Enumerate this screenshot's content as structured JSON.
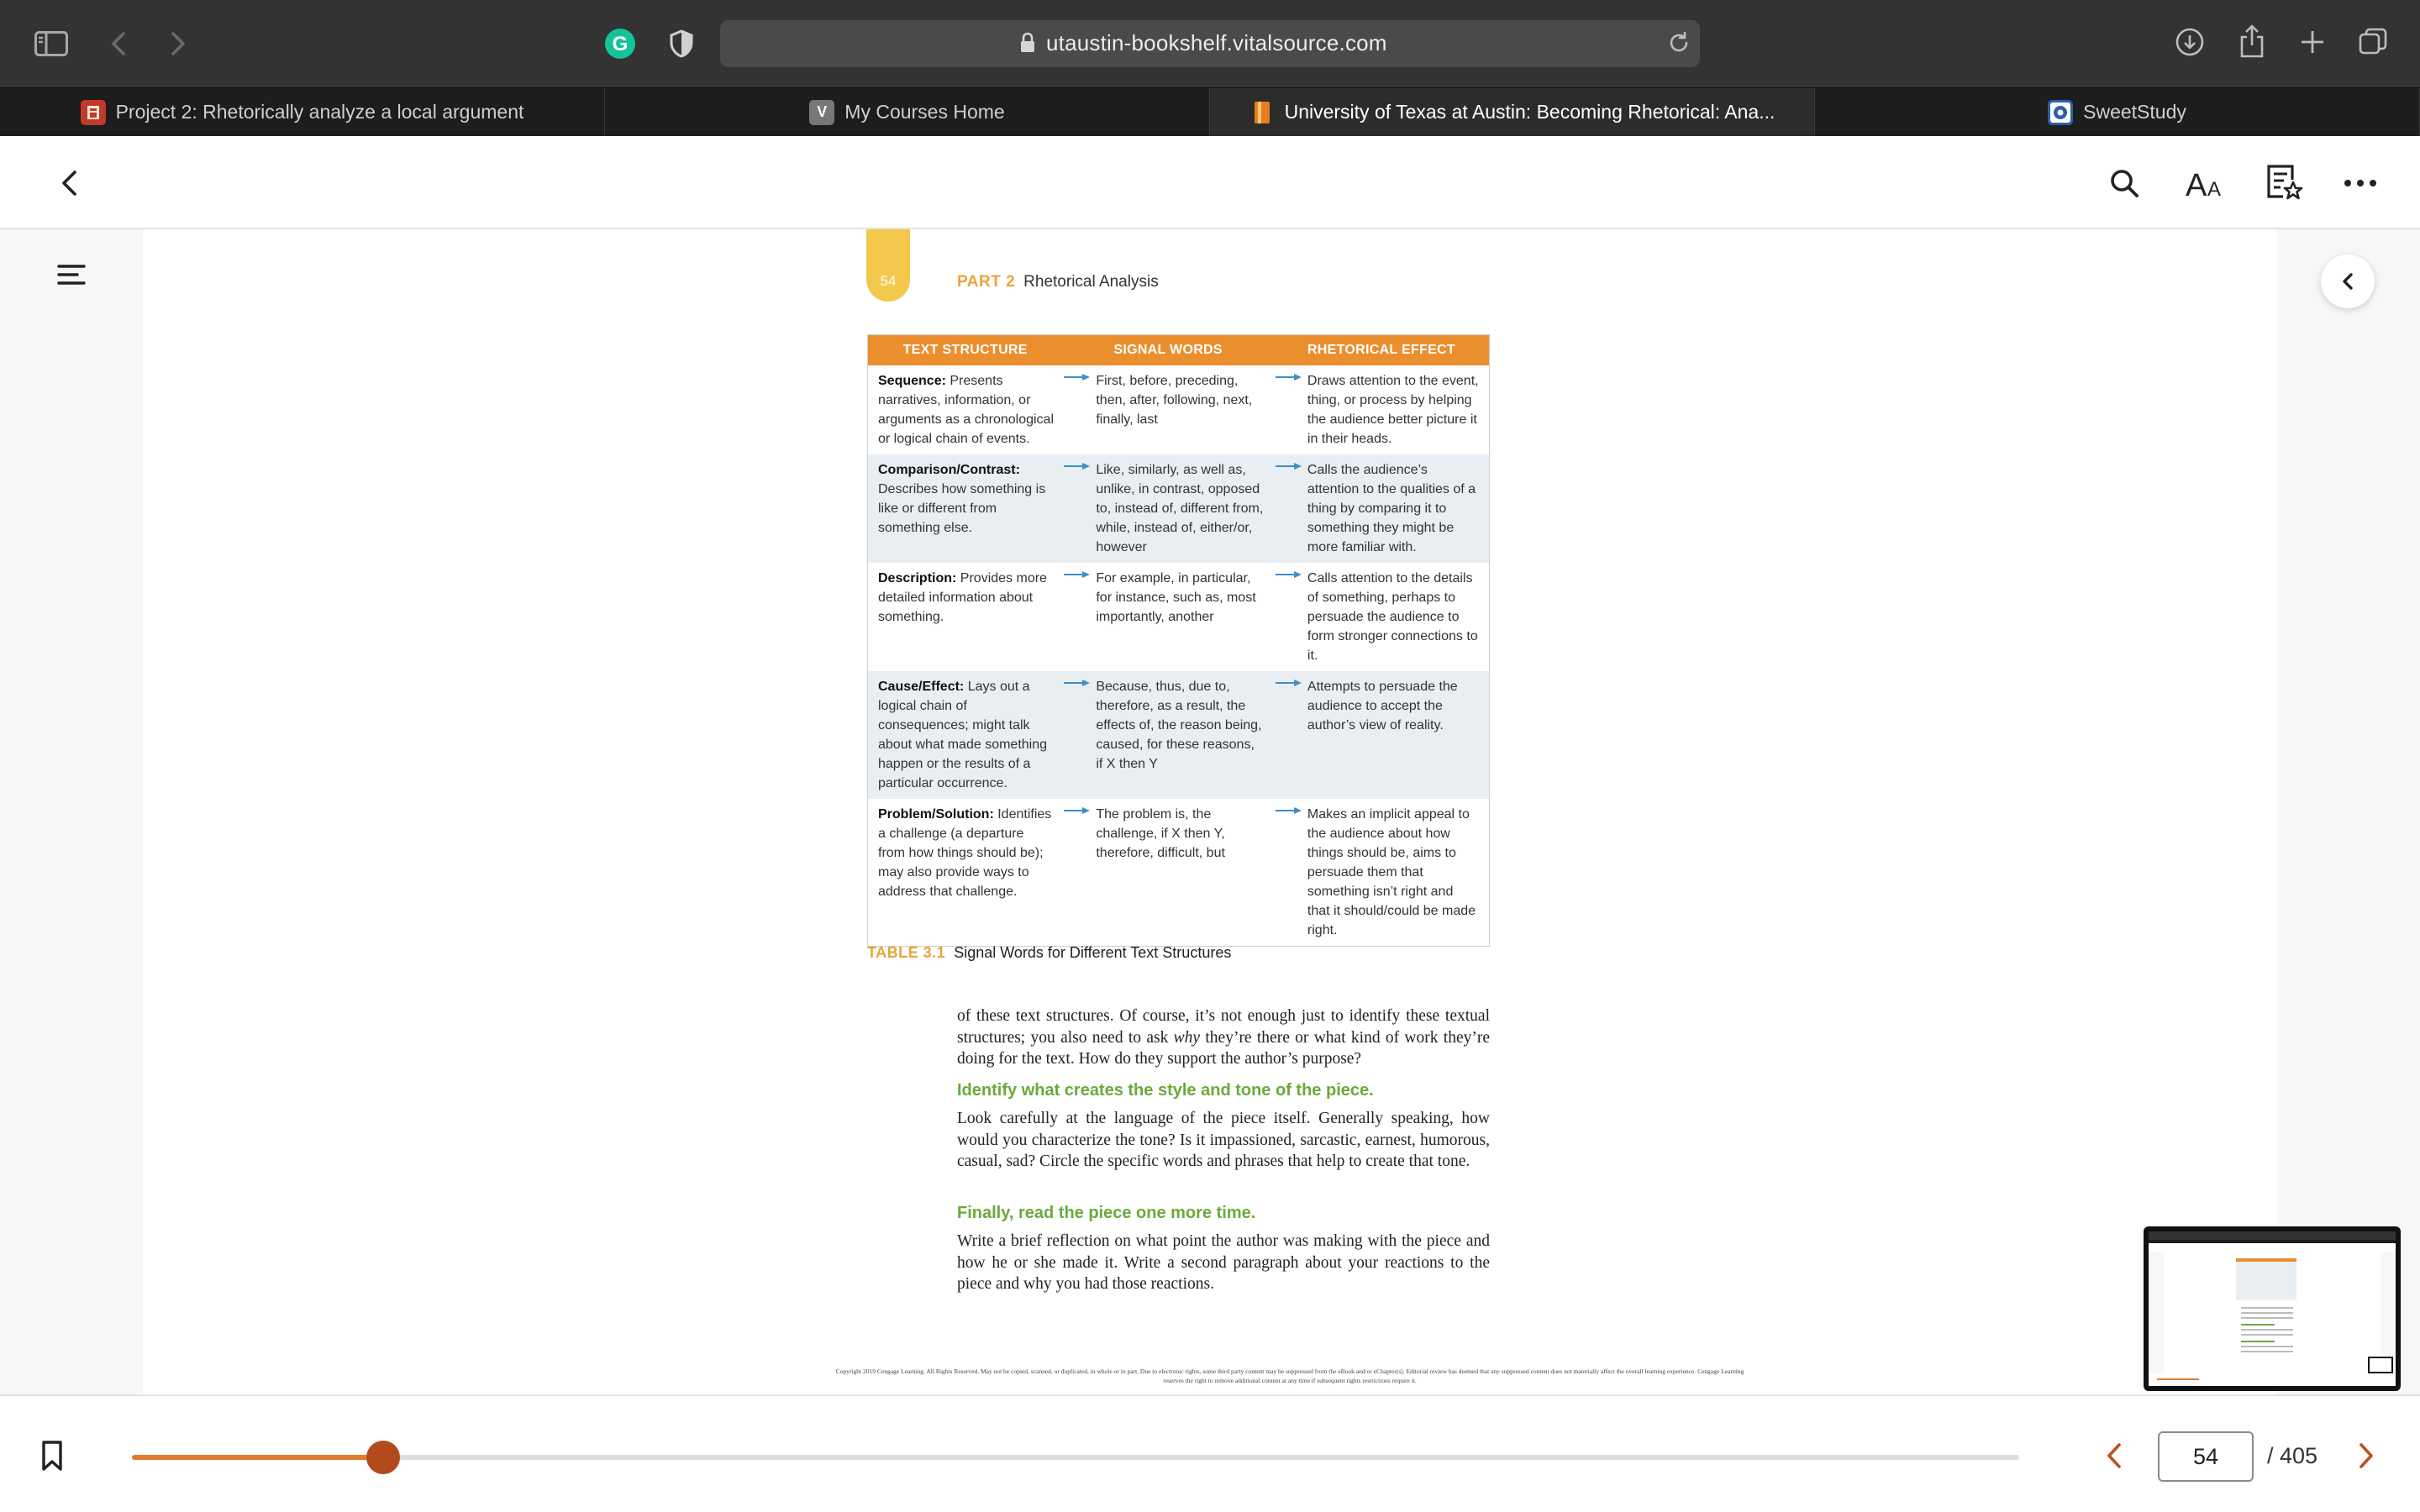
{
  "browser": {
    "url": "utaustin-bookshelf.vitalsource.com"
  },
  "tabs": [
    {
      "title": "Project 2: Rhetorically analyze a local argument",
      "favicon_color": "#c0392b",
      "favicon_letter": "",
      "active": false
    },
    {
      "title": "My Courses Home",
      "favicon_color": "#777777",
      "favicon_letter": "V",
      "active": false
    },
    {
      "title": "University of Texas at Austin: Becoming Rhetorical: Ana...",
      "favicon_color": "#e67e22",
      "favicon_letter": "",
      "active": true
    },
    {
      "title": "SweetStudy",
      "favicon_color": "#2c5fa8",
      "favicon_letter": "",
      "active": false
    }
  ],
  "book": {
    "page_number_tab": "54",
    "part_label": "PART 2",
    "part_title": "Rhetorical Analysis",
    "table": {
      "headers": [
        "TEXT STRUCTURE",
        "SIGNAL WORDS",
        "RHETORICAL EFFECT"
      ],
      "rows": [
        {
          "term": "Sequence:",
          "desc": " Presents narratives, information, or arguments as a chronological or logical chain of events.",
          "signal": "First, before, preceding, then, after, following, next, finally, last",
          "effect": "Draws attention to the event, thing, or process by helping the audience better picture it in their heads."
        },
        {
          "term": "Comparison/Contrast:",
          "desc": " Describes how something is like or different from something else.",
          "signal": "Like, similarly, as well as, unlike, in contrast, opposed to, instead of, different from, while, instead of, either/or, however",
          "effect": "Calls the audience’s attention to the qualities of a thing by comparing it to something they might be more familiar with."
        },
        {
          "term": "Description:",
          "desc": " Provides more detailed information about something.",
          "signal": "For example, in particular, for instance, such as, most importantly, another",
          "effect": "Calls attention to the details of something, perhaps to persuade the audience to form stronger connections to it."
        },
        {
          "term": "Cause/Effect:",
          "desc": " Lays out a logical chain of consequences; might talk about what made something happen or the results of a particular occurrence.",
          "signal": "Because, thus, due to, therefore, as a result, the effects of, the reason being, caused, for these reasons, if X then Y",
          "effect": "Attempts to persuade the audience to accept the author’s view of reality."
        },
        {
          "term": "Problem/Solution:",
          "desc": " Identifies a challenge (a departure from how things should be); may also provide ways to address that challenge.",
          "signal": "The problem is, the challenge, if X then Y, therefore, difficult, but",
          "effect": "Makes an implicit appeal to the audience about how things should be, aims to persuade them that something isn’t right and that it should/could be made right."
        }
      ]
    },
    "caption_label": "TABLE 3.1",
    "caption_text": "Signal Words for Different Text Structures",
    "para1_a": "of these text structures. Of course, it’s not enough just to identify these textual structures; you also need to ask ",
    "para1_em": "why",
    "para1_b": " they’re there or what kind of work they’re doing for the text. How do they support the author’s purpose?",
    "heading1": "Identify what creates the style and tone of the piece.",
    "para2": "Look carefully at the language of the piece itself. Generally speaking, how would you characterize the tone? Is it impassioned, sarcastic, earnest, humorous, casual, sad? Circle the specific words and phrases that help to create that tone.",
    "heading2": "Finally, read the piece one more time.",
    "para3": "Write a brief reflection on what point the author was making with the piece and how he or she made it. Write a second paragraph about your reactions to the piece and why you had those reactions.",
    "copyright": "Copyright 2019 Cengage Learning. All Rights Reserved. May not be copied, scanned, or duplicated, in whole or in part. Due to electronic rights, some third party content may be suppressed from the eBook and/or eChapter(s). Editorial review has deemed that any suppressed content does not materially affect the overall learning experience. Cengage Learning reserves the right to remove additional content at any time if subsequent rights restrictions require it."
  },
  "navigation": {
    "current_page": "54",
    "total_pages": "/ 405",
    "progress_fraction": 0.133
  },
  "colors": {
    "accent": "#e07b2f",
    "slider_thumb": "#b34a1c",
    "table_header": "#eb8e2e",
    "heading_green": "#6aaa3a",
    "arrow_blue": "#3d8fc9"
  }
}
